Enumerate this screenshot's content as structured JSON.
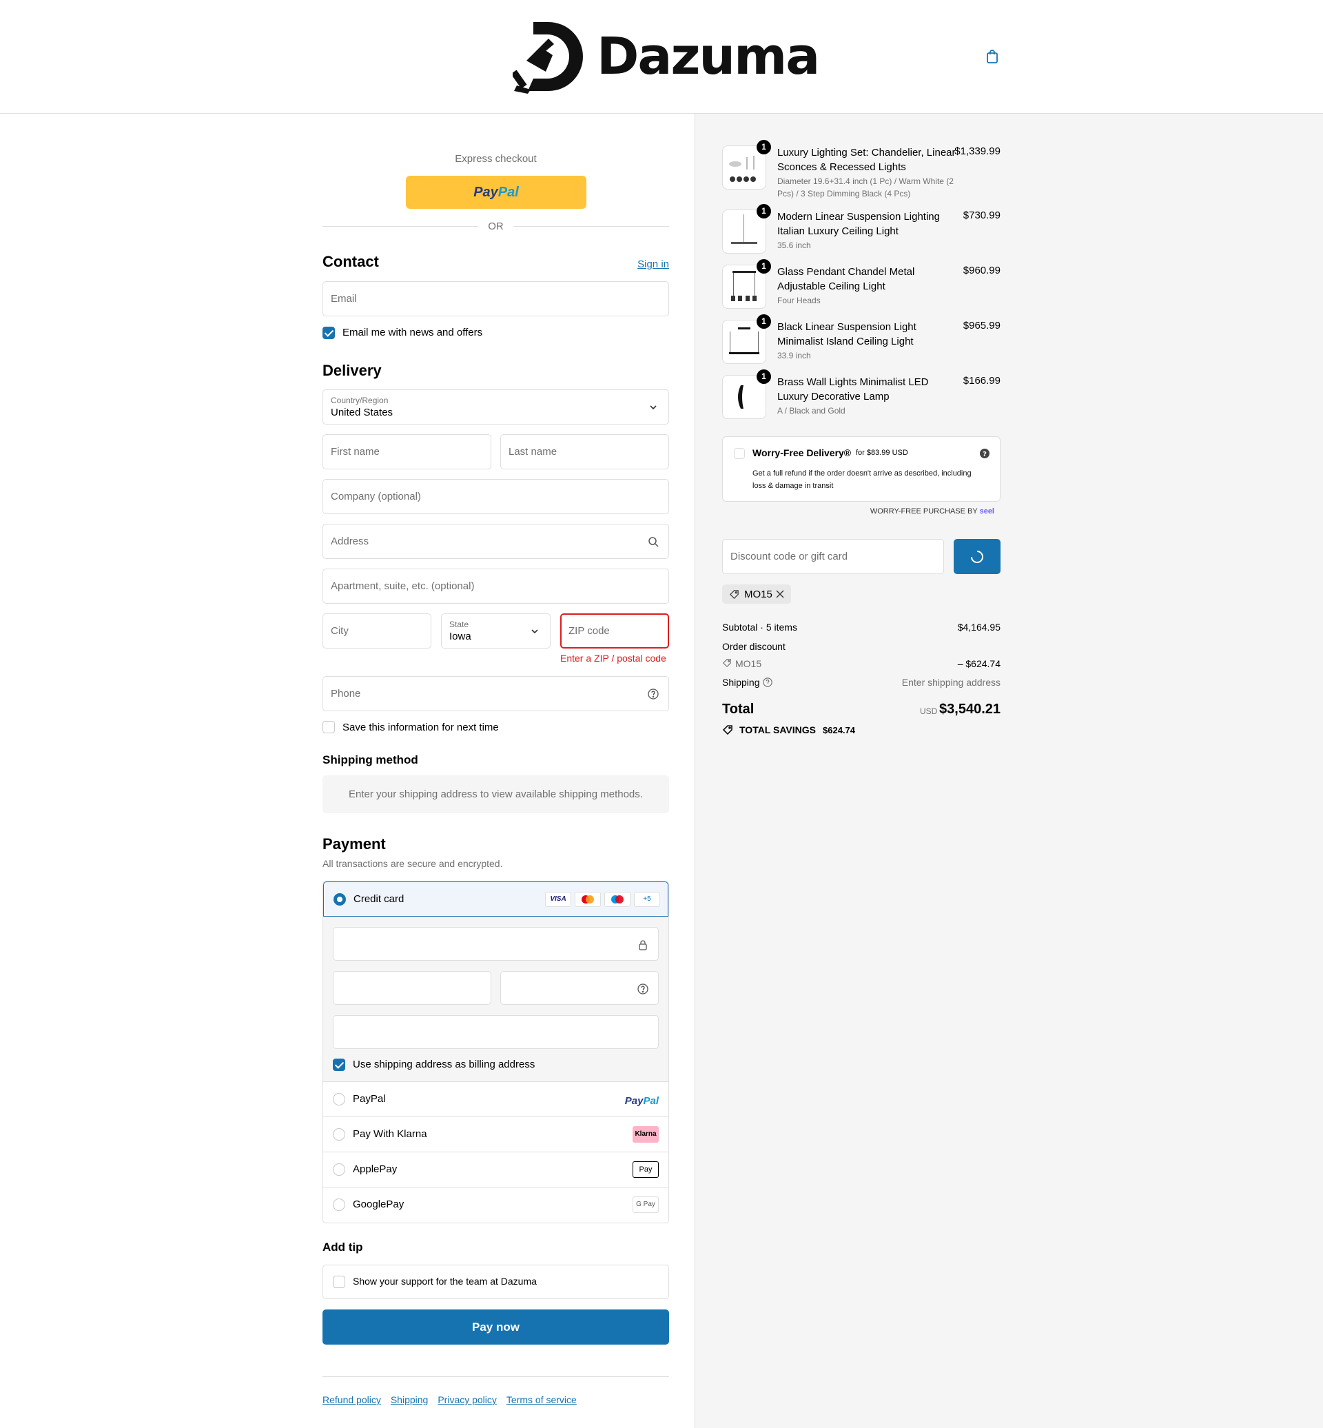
{
  "header": {
    "brand": "Dazuma"
  },
  "express": {
    "title": "Express checkout",
    "or": "OR",
    "paypal_a": "Pay",
    "paypal_b": "Pal"
  },
  "contact": {
    "title": "Contact",
    "sign_in": "Sign in",
    "email_placeholder": "Email",
    "news_label": "Email me with news and offers",
    "news_checked": true
  },
  "delivery": {
    "title": "Delivery",
    "country_label": "Country/Region",
    "country_value": "United States",
    "first_name": "First name",
    "last_name": "Last name",
    "company": "Company (optional)",
    "address": "Address",
    "apartment": "Apartment, suite, etc. (optional)",
    "city": "City",
    "state_label": "State",
    "state_value": "Iowa",
    "zip": "ZIP code",
    "zip_error": "Enter a ZIP / postal code",
    "phone": "Phone",
    "save_label": "Save this information for next time"
  },
  "shipping": {
    "title": "Shipping method",
    "message": "Enter your shipping address to view available shipping methods."
  },
  "payment": {
    "title": "Payment",
    "subtitle": "All transactions are secure and encrypted.",
    "credit_card": "Credit card",
    "card_logos": [
      "VISA",
      "",
      "",
      "+5"
    ],
    "billing_label": "Use shipping address as billing address",
    "options": [
      "PayPal",
      "Pay With Klarna",
      "ApplePay",
      "GooglePay"
    ],
    "klarna_logo": "Klarna",
    "applepay_logo": "Pay",
    "googlepay_logo": "G Pay"
  },
  "tip": {
    "title": "Add tip",
    "label": "Show your support for the team at Dazuma"
  },
  "pay_now": "Pay now",
  "footer": {
    "links": [
      "Refund policy",
      "Shipping",
      "Privacy policy",
      "Terms of service"
    ]
  },
  "cart": {
    "items": [
      {
        "name": "Luxury Lighting Set: Chandelier, Linear Sconces & Recessed Lights",
        "variant": "Diameter 19.6+31.4 inch (1 Pc) / Warm White (2 Pcs) / 3 Step Dimming Black (4 Pcs)",
        "price": "$1,339.99",
        "qty": "1"
      },
      {
        "name": "Modern Linear Suspension Lighting Italian Luxury Ceiling Light",
        "variant": "35.6 inch",
        "price": "$730.99",
        "qty": "1"
      },
      {
        "name": "Glass Pendant Chandel Metal Adjustable Ceiling Light",
        "variant": "Four Heads",
        "price": "$960.99",
        "qty": "1"
      },
      {
        "name": "Black Linear Suspension Light Minimalist Island Ceiling Light",
        "variant": "33.9 inch",
        "price": "$965.99",
        "qty": "1"
      },
      {
        "name": "Brass Wall Lights Minimalist LED Luxury Decorative Lamp",
        "variant": "A / Black and Gold",
        "price": "$166.99",
        "qty": "1"
      }
    ]
  },
  "worry_free": {
    "title": "Worry-Free Delivery®",
    "price": "for $83.99 USD",
    "desc": "Get a full refund if the order doesn't arrive as described, including loss & damage in transit",
    "brand_line": "WORRY-FREE PURCHASE BY",
    "brand": "seel"
  },
  "discount": {
    "placeholder": "Discount code or gift card",
    "code": "MO15"
  },
  "summary": {
    "subtotal_label": "Subtotal · 5 items",
    "subtotal": "$4,164.95",
    "order_discount": "Order discount",
    "code": "MO15",
    "discount_value": "– $624.74",
    "shipping_label": "Shipping",
    "shipping_value": "Enter shipping address",
    "total_label": "Total",
    "currency": "USD",
    "total": "$3,540.21",
    "savings_label": "TOTAL SAVINGS",
    "savings": "$624.74"
  },
  "colors": {
    "accent": "#1773b0",
    "paypal": "#ffc439",
    "error": "#dd1d1d"
  }
}
